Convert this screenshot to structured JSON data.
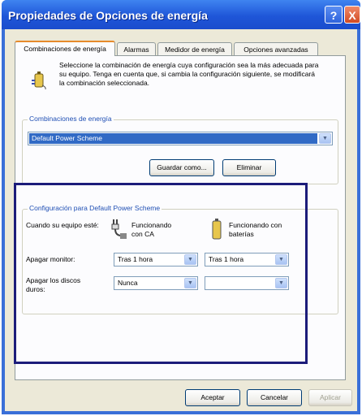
{
  "window": {
    "title": "Propiedades de Opciones de energía",
    "help": "?",
    "close": "X"
  },
  "tabs": [
    {
      "label": "Combinaciones de energía"
    },
    {
      "label": "Alarmas"
    },
    {
      "label": "Medidor de energía"
    },
    {
      "label": "Opciones avanzadas"
    }
  ],
  "description": "Seleccione la combinación de energía cuya configuración sea la más adecuada para su equipo. Tenga en cuenta que, si cambia la configuración siguiente, se modificará la combinación seleccionada.",
  "schemes": {
    "group_label": "Combinaciones de energía",
    "selected": "Default Power Scheme",
    "save_as": "Guardar como...",
    "delete": "Eliminar"
  },
  "settings": {
    "group_label": "Configuración para Default Power Scheme",
    "when_label": "Cuando su equipo esté:",
    "ac_label": "Funcionando con CA",
    "battery_label": "Funcionando con baterías",
    "monitor_label": "Apagar monitor:",
    "monitor_ac": "Tras 1 hora",
    "monitor_battery": "Tras 1 hora",
    "disks_label": "Apagar los discos duros:",
    "disks_ac": "Nunca",
    "disks_battery": ""
  },
  "footer": {
    "accept": "Aceptar",
    "cancel": "Cancelar",
    "apply": "Aplicar"
  },
  "colors": {
    "highlight_rect": "#1c1c7a",
    "titlebar": "#1f56d8"
  },
  "icons": [
    "battery-plug-icon",
    "plug-icon",
    "battery-icon",
    "chevron-down-icon"
  ]
}
